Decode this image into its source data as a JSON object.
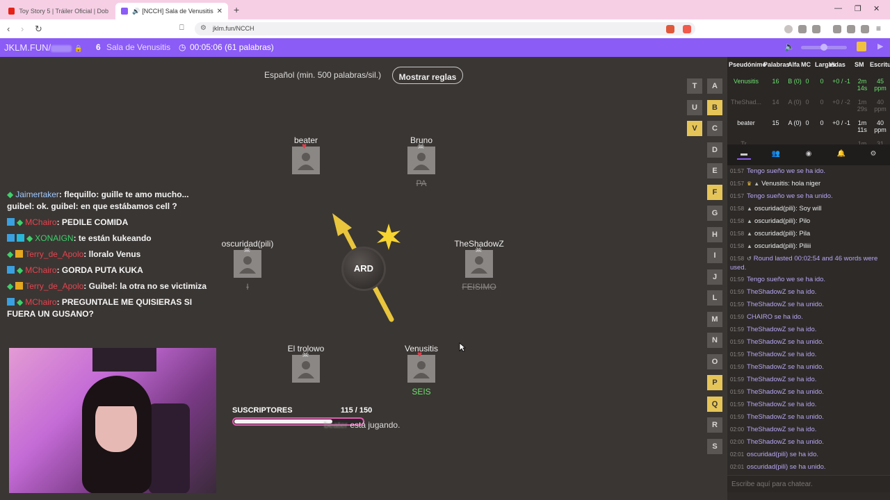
{
  "browser": {
    "tabs": [
      {
        "title": "Toy Story 5 | Tráiler Oficial | Doblado",
        "active": false
      },
      {
        "title": "[NCCH] Sala de Venusitis",
        "active": true
      }
    ],
    "url": "jklm.fun/NCCH"
  },
  "gamebar": {
    "brand": "JKLM.FUN/",
    "player_count": "6",
    "room_name": "Sala de Venusitis",
    "timer": "00:05:06 (61 palabras)"
  },
  "board": {
    "language": "Español (min. 500 palabras/sil.)",
    "rules_button": "Mostrar reglas",
    "syllable": "ARD",
    "players": [
      {
        "name": "beater",
        "word": ""
      },
      {
        "name": "Bruno",
        "word": "PA"
      },
      {
        "name": "oscuridad(pili)",
        "word": "I"
      },
      {
        "name": "TheShadowZ",
        "word": "FEISIMO"
      },
      {
        "name": "El trolowo",
        "word": ""
      },
      {
        "name": "Venusitis",
        "word": "SEIS"
      }
    ],
    "status_suffix": "está jugando.",
    "status_name": "beater"
  },
  "alphabet": {
    "letters": [
      "T",
      "A",
      "U",
      "B",
      "V",
      "C",
      "D",
      "E",
      "F",
      "G",
      "H",
      "I",
      "J",
      "L",
      "M",
      "N",
      "O",
      "P",
      "Q",
      "R",
      "S"
    ],
    "used": [
      "B",
      "V",
      "F",
      "P",
      "Q"
    ]
  },
  "stream_chat": [
    {
      "user": "Jaimertaker",
      "color": "#9ec9ff",
      "text": ": flequillo: guille te amo mucho... guibel: ok. guibel: en que estábamos cell ?"
    },
    {
      "user": "MChairo",
      "color": "#e8434f",
      "text": ": PEDILE COMIDA"
    },
    {
      "user": "XONAIGN",
      "color": "#3ed06b",
      "text": ": te están kukeando"
    },
    {
      "user": "Terry_de_Apolo",
      "color": "#e8434f",
      "text": ": lloralo Venus"
    },
    {
      "user": "MChairo",
      "color": "#e8434f",
      "text": ": GORDA PUTA KUKA"
    },
    {
      "user": "Terry_de_Apolo",
      "color": "#e8434f",
      "text": ": Guibel: la otra no se victimiza"
    },
    {
      "user": "MChairo",
      "color": "#e8434f",
      "text": ": PREGUNTALE ME QUISIERAS SI FUERA UN GUSANO?"
    }
  ],
  "subs": {
    "label": "SUSCRIPTORES",
    "value": "115 / 150",
    "fraction": 0.767
  },
  "scoreboard": {
    "headers": [
      "Pseudónimo",
      "Palabras",
      "Alfa",
      "MC",
      "Largas",
      "Vidas",
      "SM",
      "Escritura"
    ],
    "rows": [
      {
        "name": "Venusitis",
        "words": "16",
        "alfa": "B (0)",
        "mc": "0",
        "largas": "0",
        "vidas": "+0 / -1",
        "sm": "2m 14s",
        "speed": "45 ppm",
        "style": "me"
      },
      {
        "name": "TheShad...",
        "words": "14",
        "alfa": "A (0)",
        "mc": "0",
        "largas": "0",
        "vidas": "+0 / -2",
        "sm": "1m 29s",
        "speed": "40 ppm",
        "style": "dim"
      },
      {
        "name": "beater",
        "words": "15",
        "alfa": "A (0)",
        "mc": "0",
        "largas": "0",
        "vidas": "+0 / -1",
        "sm": "1m 11s",
        "speed": "40 ppm",
        "style": "other"
      },
      {
        "name": "Tr...",
        "words": "",
        "alfa": "",
        "mc": "",
        "largas": "",
        "vidas": "",
        "sm": "1m",
        "speed": "31",
        "style": "dim"
      }
    ]
  },
  "log": [
    {
      "t": "01:57",
      "who": "",
      "text": "Tengo sueño we se ha ido."
    },
    {
      "t": "01:57",
      "who": "Venusitis:",
      "text": " hola niger",
      "crown": true
    },
    {
      "t": "01:57",
      "who": "",
      "text": "Tengo sueño we se ha unido."
    },
    {
      "t": "01:58",
      "who": "oscuridad(pili):",
      "text": " Soy will",
      "user": true
    },
    {
      "t": "01:58",
      "who": "oscuridad(pili):",
      "text": " Pilo",
      "user": true
    },
    {
      "t": "01:58",
      "who": "oscuridad(pili):",
      "text": " Pila",
      "user": true
    },
    {
      "t": "01:58",
      "who": "oscuridad(pili):",
      "text": " Piliii",
      "user": true
    },
    {
      "t": "01:58",
      "who": "",
      "text": "Round lasted 00:02:54 and 46 words were used.",
      "round": true
    },
    {
      "t": "01:59",
      "who": "",
      "text": "Tengo sueño we se ha ido."
    },
    {
      "t": "01:59",
      "who": "",
      "text": "TheShadowZ se ha ido."
    },
    {
      "t": "01:59",
      "who": "",
      "text": "TheShadowZ se ha unido."
    },
    {
      "t": "01:59",
      "who": "",
      "text": "CHAIRO se ha ido."
    },
    {
      "t": "01:59",
      "who": "",
      "text": "TheShadowZ se ha ido."
    },
    {
      "t": "01:59",
      "who": "",
      "text": "TheShadowZ se ha unido."
    },
    {
      "t": "01:59",
      "who": "",
      "text": "TheShadowZ se ha ido."
    },
    {
      "t": "01:59",
      "who": "",
      "text": "TheShadowZ se ha unido."
    },
    {
      "t": "01:59",
      "who": "",
      "text": "TheShadowZ se ha ido."
    },
    {
      "t": "01:59",
      "who": "",
      "text": "TheShadowZ se ha unido."
    },
    {
      "t": "01:59",
      "who": "",
      "text": "TheShadowZ se ha ido."
    },
    {
      "t": "01:59",
      "who": "",
      "text": "TheShadowZ se ha unido."
    },
    {
      "t": "02:00",
      "who": "",
      "text": "TheShadowZ se ha ido."
    },
    {
      "t": "02:00",
      "who": "",
      "text": "TheShadowZ se ha unido."
    },
    {
      "t": "02:01",
      "who": "",
      "text": "oscuridad(pili) se ha ido."
    },
    {
      "t": "02:01",
      "who": "",
      "text": "oscuridad(pili) se ha unido."
    }
  ],
  "chat_input": {
    "placeholder": "Escribe aquí para chatear."
  },
  "colors": {
    "accent": "#8b5cf6",
    "letter_used": "#e6c558",
    "self_green": "#6ee06e"
  }
}
